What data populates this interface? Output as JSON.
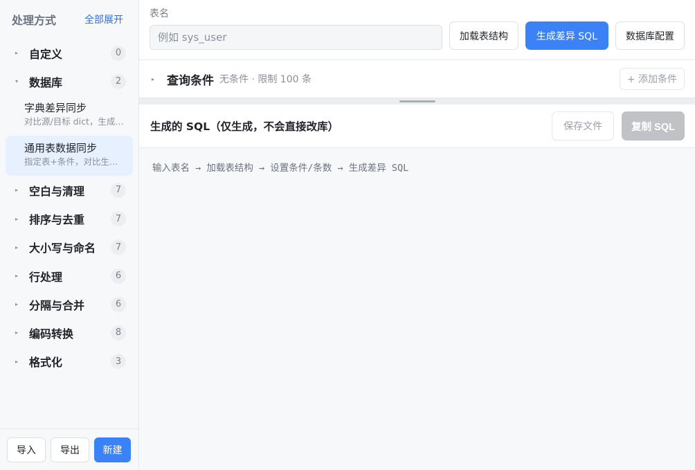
{
  "sidebar": {
    "title": "处理方式",
    "expand_all": "全部展开",
    "categories": [
      {
        "label": "自定义",
        "count": "0",
        "expanded": false
      },
      {
        "label": "数据库",
        "count": "2",
        "expanded": true
      },
      {
        "label": "空白与清理",
        "count": "7",
        "expanded": false
      },
      {
        "label": "排序与去重",
        "count": "7",
        "expanded": false
      },
      {
        "label": "大小写与命名",
        "count": "7",
        "expanded": false
      },
      {
        "label": "行处理",
        "count": "6",
        "expanded": false
      },
      {
        "label": "分隔与合并",
        "count": "6",
        "expanded": false
      },
      {
        "label": "编码转换",
        "count": "8",
        "expanded": false
      },
      {
        "label": "格式化",
        "count": "3",
        "expanded": false
      }
    ],
    "db_items": [
      {
        "title": "字典差异同步",
        "desc": "对比源/目标 dict，生成差异 SQL"
      },
      {
        "title": "通用表数据同步",
        "desc": "指定表+条件，对比生成同步 SQL"
      }
    ],
    "footer": {
      "import": "导入",
      "export": "导出",
      "new": "新建"
    }
  },
  "topbar": {
    "table_label": "表名",
    "table_placeholder": "例如 sys_user",
    "load_button": "加载表结构",
    "generate_button": "生成差异 SQL",
    "db_config_button": "数据库配置"
  },
  "conditions": {
    "title": "查询条件",
    "meta": "无条件 · 限制 100 条",
    "add_button": "+ 添加条件"
  },
  "sql": {
    "title": "生成的 SQL（仅生成，不会直接改库）",
    "save_button": "保存文件",
    "copy_button": "复制 SQL",
    "hint": "输入表名 → 加载表结构 → 设置条件/条数 → 生成差异 SQL"
  },
  "colors": {
    "accent": "#3b82f6",
    "active_bg": "#e7f0ff",
    "disabled": "#c0c2c5"
  },
  "icons": {
    "collapsed": "▸",
    "expanded": "▾"
  }
}
